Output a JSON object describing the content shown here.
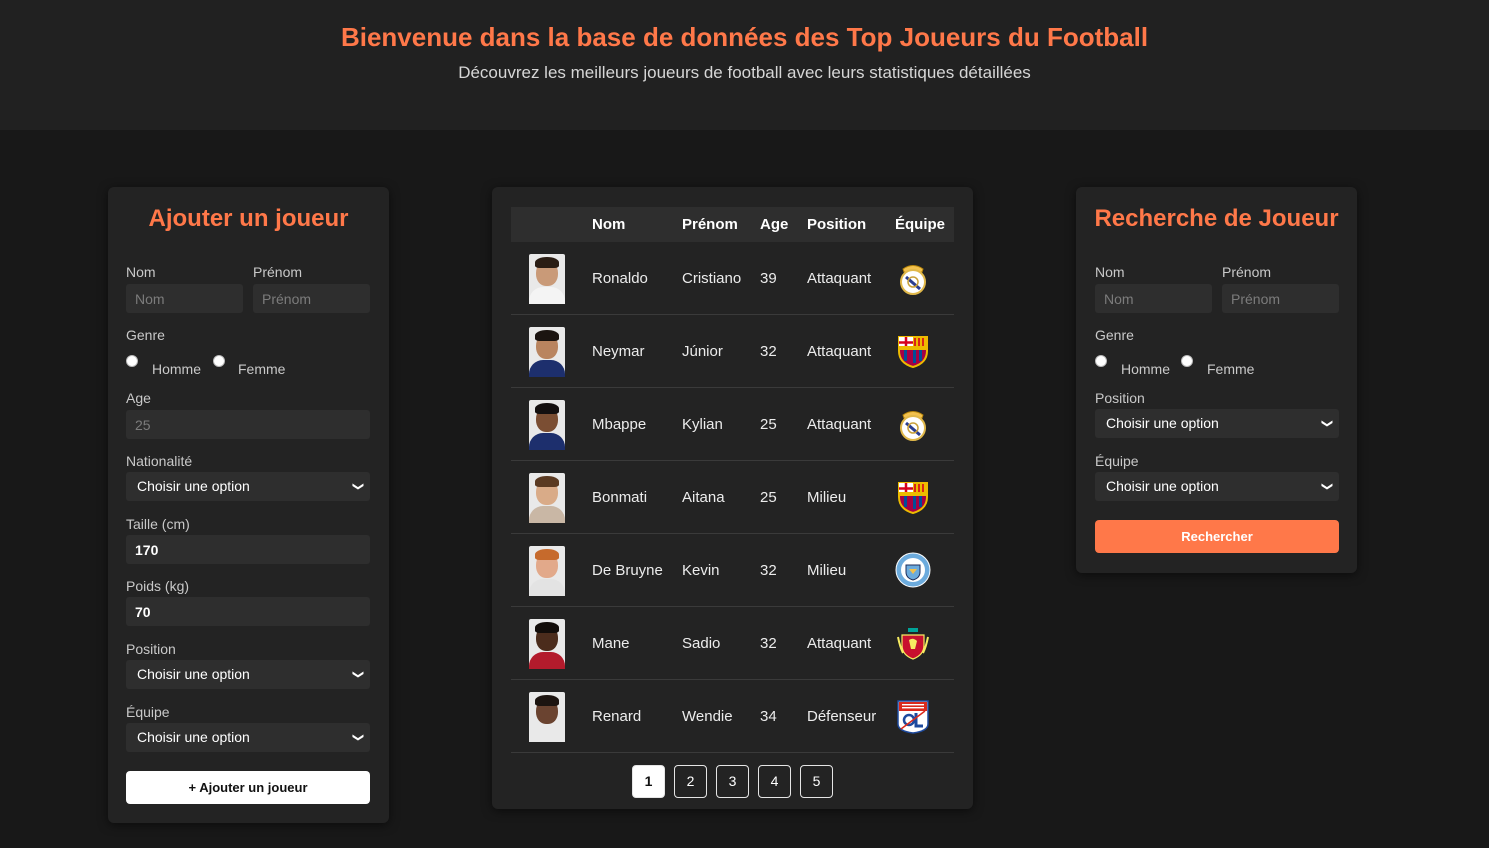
{
  "header": {
    "title": "Bienvenue dans la base de données des Top Joueurs du Football",
    "subtitle": "Découvrez les meilleurs joueurs de football avec leurs statistiques détaillées"
  },
  "add_form": {
    "title": "Ajouter un joueur",
    "nom_label": "Nom",
    "nom_placeholder": "Nom",
    "prenom_label": "Prénom",
    "prenom_placeholder": "Prénom",
    "genre_label": "Genre",
    "homme_label": "Homme",
    "femme_label": "Femme",
    "age_label": "Age",
    "age_placeholder": "25",
    "nationalite_label": "Nationalité",
    "nationalite_value": "Choisir une option",
    "taille_label": "Taille (cm)",
    "taille_value": "170",
    "poids_label": "Poids (kg)",
    "poids_value": "70",
    "position_label": "Position",
    "position_value": "Choisir une option",
    "equipe_label": "Équipe",
    "equipe_value": "Choisir une option",
    "submit_label": "+ Ajouter un joueur"
  },
  "table": {
    "headers": [
      "",
      "Nom",
      "Prénom",
      "Age",
      "Position",
      "Équipe"
    ],
    "rows": [
      {
        "nom": "Ronaldo",
        "prenom": "Cristiano",
        "age": "39",
        "position": "Attaquant",
        "team_icon": "real-madrid-crest-icon"
      },
      {
        "nom": "Neymar",
        "prenom": "Júnior",
        "age": "32",
        "position": "Attaquant",
        "team_icon": "fc-barcelona-crest-icon"
      },
      {
        "nom": "Mbappe",
        "prenom": "Kylian",
        "age": "25",
        "position": "Attaquant",
        "team_icon": "real-madrid-crest-icon"
      },
      {
        "nom": "Bonmati",
        "prenom": "Aitana",
        "age": "25",
        "position": "Milieu",
        "team_icon": "fc-barcelona-crest-icon"
      },
      {
        "nom": "De Bruyne",
        "prenom": "Kevin",
        "age": "32",
        "position": "Milieu",
        "team_icon": "manchester-city-crest-icon"
      },
      {
        "nom": "Mane",
        "prenom": "Sadio",
        "age": "32",
        "position": "Attaquant",
        "team_icon": "liverpool-crest-icon"
      },
      {
        "nom": "Renard",
        "prenom": "Wendie",
        "age": "34",
        "position": "Défenseur",
        "team_icon": "olympique-lyonnais-crest-icon"
      }
    ],
    "pages": [
      "1",
      "2",
      "3",
      "4",
      "5"
    ],
    "current_page": "1"
  },
  "search_form": {
    "title": "Recherche de Joueur",
    "nom_label": "Nom",
    "nom_placeholder": "Nom",
    "prenom_label": "Prénom",
    "prenom_placeholder": "Prénom",
    "genre_label": "Genre",
    "homme_label": "Homme",
    "femme_label": "Femme",
    "position_label": "Position",
    "position_value": "Choisir une option",
    "equipe_label": "Équipe",
    "equipe_value": "Choisir une option",
    "submit_label": "Rechercher"
  },
  "colors": {
    "accent": "#ff7849",
    "page_bg": "#181818",
    "card_bg": "#232323",
    "header_bg": "#212121"
  }
}
